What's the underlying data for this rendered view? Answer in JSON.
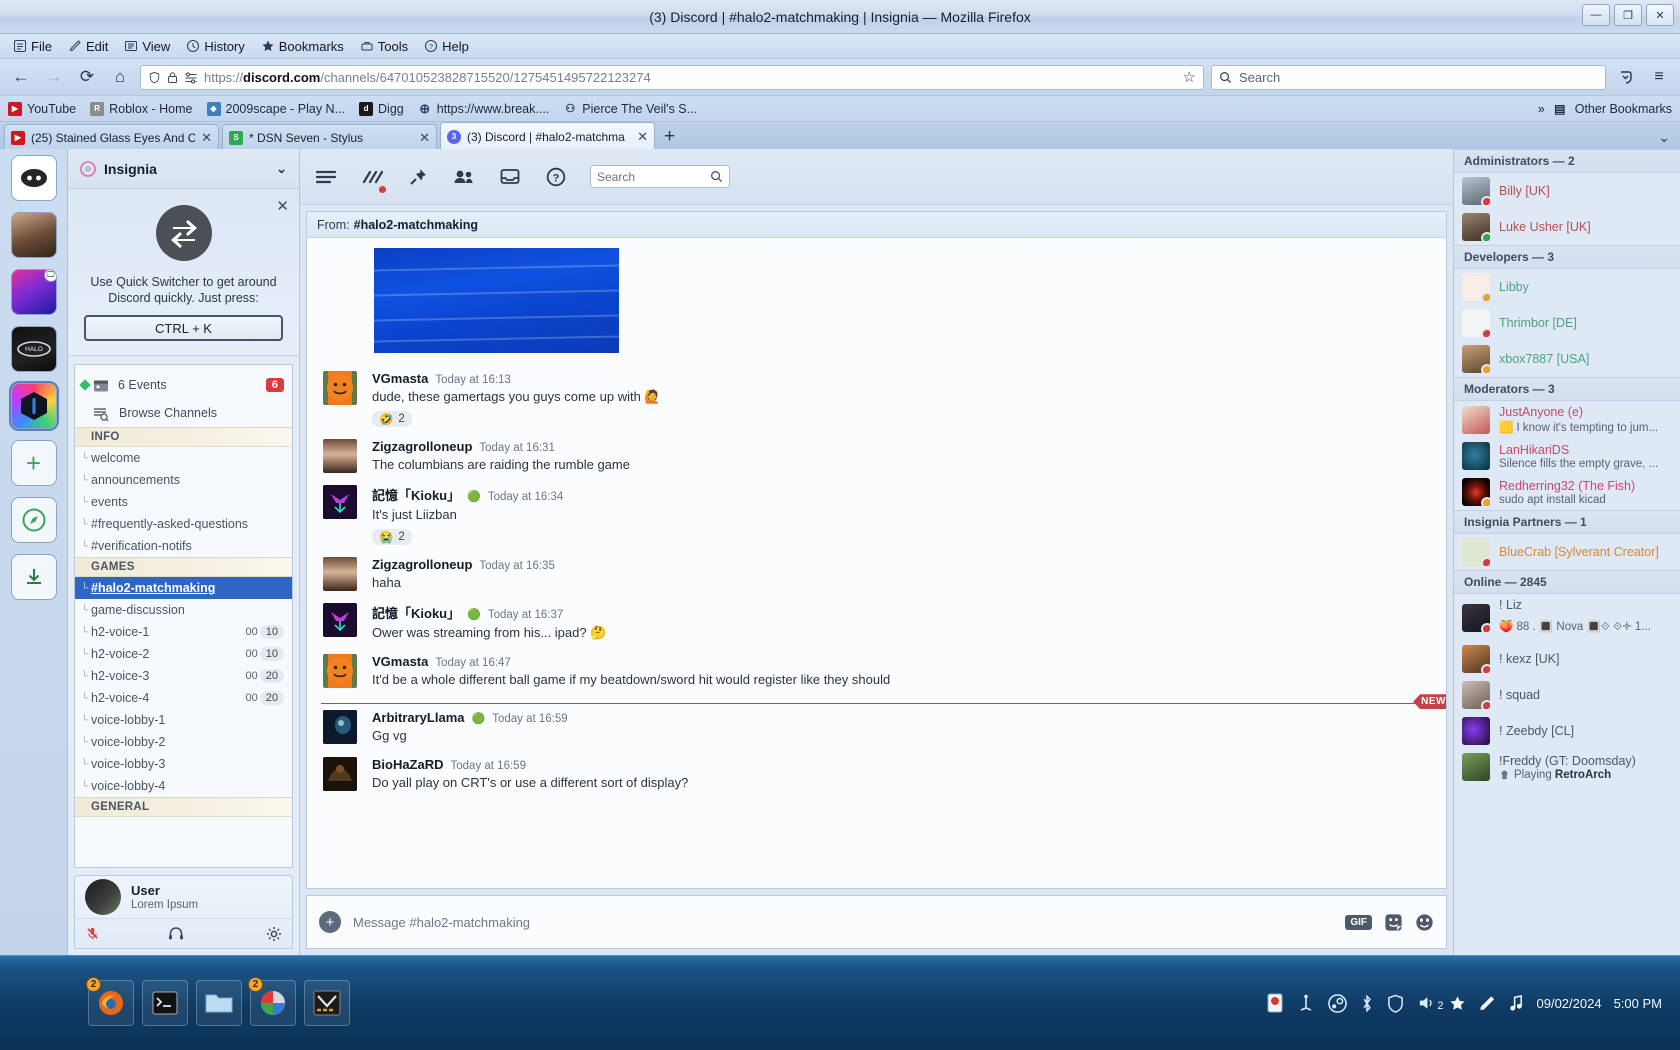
{
  "window": {
    "title": "(3) Discord | #halo2-matchmaking | Insignia — Mozilla Firefox",
    "minimize": "—",
    "restore": "❐",
    "close": "✕"
  },
  "menubar": [
    {
      "label": "File",
      "icon": "file-icon"
    },
    {
      "label": "Edit",
      "icon": "edit-pencil-icon"
    },
    {
      "label": "View",
      "icon": "view-icon"
    },
    {
      "label": "History",
      "icon": "clock-icon"
    },
    {
      "label": "Bookmarks",
      "icon": "star-icon"
    },
    {
      "label": "Tools",
      "icon": "tools-icon"
    },
    {
      "label": "Help",
      "icon": "help-circle-icon"
    }
  ],
  "nav": {
    "back": "←",
    "forward": "→",
    "reload": "⟳",
    "home": "⌂",
    "url_host": "discord.com",
    "url_path": "/channels/647010523828715520/1275451495722123274",
    "url_scheme": "https://",
    "bookmark_star": "☆",
    "search_placeholder": "Search",
    "pocket": "save-to-pocket-icon",
    "menu": "≡"
  },
  "bookmarks": {
    "items": [
      {
        "label": "YouTube",
        "color": "#cc181e",
        "glyph": "▶"
      },
      {
        "label": "Roblox - Home",
        "color": "#8c8c8c",
        "glyph": "R"
      },
      {
        "label": "2009scape - Play N...",
        "color": "#3d7fbf",
        "glyph": "◆"
      },
      {
        "label": "Digg",
        "color": "#1a1a1a",
        "glyph": "d"
      },
      {
        "label": "https://www.break....",
        "color": "#3a7fc1",
        "glyph": "⊕"
      },
      {
        "label": "Pierce The Veil's S...",
        "color": "#2b3a4d",
        "glyph": "⚇"
      }
    ],
    "overflow": "»",
    "other": "Other Bookmarks"
  },
  "tabs": [
    {
      "label": "(25) Stained Glass Eyes And C",
      "favicon": "youtube-icon",
      "color": "#cc181e",
      "glyph": "▶",
      "active": false
    },
    {
      "label": "* DSN Seven - Stylus",
      "favicon": "stylus-icon",
      "color": "#2fa84f",
      "glyph": "S",
      "active": false
    },
    {
      "label": "(3) Discord | #halo2-matchma",
      "favicon": "discord-icon",
      "color": "#5865f2",
      "glyph": "3",
      "active": true
    }
  ],
  "tabbar": {
    "new_tab": "+",
    "list_all": "⌄"
  },
  "discord": {
    "guild_name": "Insignia",
    "guild_chevron": "⌄",
    "quick_switcher": {
      "close": "✕",
      "text": "Use Quick Switcher to get around Discord quickly. Just press:",
      "shortcut": "CTRL + K"
    },
    "events": {
      "label": "6 Events",
      "badge": "6"
    },
    "browse_channels": "Browse Channels",
    "categories": [
      {
        "name": "INFO",
        "channels": [
          {
            "name": "welcome",
            "active": false
          },
          {
            "name": "announcements",
            "active": false
          },
          {
            "name": "events",
            "active": false
          },
          {
            "name": "#frequently-asked-questions",
            "active": false
          },
          {
            "name": "#verification-notifs",
            "active": false
          }
        ]
      },
      {
        "name": "GAMES",
        "channels": [
          {
            "name": "#halo2-matchmaking",
            "active": true
          },
          {
            "name": "game-discussion",
            "active": false
          },
          {
            "name": "h2-voice-1",
            "active": false,
            "count": "00",
            "limit": "10"
          },
          {
            "name": "h2-voice-2",
            "active": false,
            "count": "00",
            "limit": "10"
          },
          {
            "name": "h2-voice-3",
            "active": false,
            "count": "00",
            "limit": "20"
          },
          {
            "name": "h2-voice-4",
            "active": false,
            "count": "00",
            "limit": "20"
          },
          {
            "name": "voice-lobby-1",
            "active": false
          },
          {
            "name": "voice-lobby-2",
            "active": false
          },
          {
            "name": "voice-lobby-3",
            "active": false
          },
          {
            "name": "voice-lobby-4",
            "active": false
          }
        ]
      },
      {
        "name": "GENERAL",
        "channels": []
      }
    ],
    "user_panel": {
      "name": "User",
      "status": "Lorem Ipsum",
      "mic": "microphone-muted-icon",
      "headset": "headset-icon",
      "settings": "gear-icon"
    },
    "toolbar": {
      "threads": "threads-icon",
      "activity": "activity-icon",
      "pins": "pin-icon",
      "members": "members-icon",
      "inbox": "inbox-icon",
      "help": "help-icon",
      "search_placeholder": "Search"
    },
    "from_label": "From:",
    "from_channel": "#halo2-matchmaking",
    "new_divider": "NEW",
    "messages": [
      {
        "author": "VGmasta",
        "badge": "",
        "time": "Today at 16:13",
        "text": "dude, these gamertags you guys come up with 🙋",
        "reaction": {
          "emoji": "🤣",
          "count": "2"
        },
        "avatar_type": "smiley-orange"
      },
      {
        "author": "Zigzagrolloneup",
        "badge": "",
        "time": "Today at 16:31",
        "text": "The columbians are raiding the rumble game",
        "avatar_type": "photo-man"
      },
      {
        "author": "記憶「Kioku」",
        "badge": "🟢",
        "time": "Today at 16:34",
        "text": "It's just Liizban",
        "reaction": {
          "emoji": "😭",
          "count": "2"
        },
        "avatar_type": "purple-crest"
      },
      {
        "author": "Zigzagrolloneup",
        "badge": "",
        "time": "Today at 16:35",
        "text": "haha",
        "avatar_type": "photo-man"
      },
      {
        "author": "記憶「Kioku」",
        "badge": "🟢",
        "time": "Today at 16:37",
        "text": "Ower was streaming from his... ipad? 🤔",
        "avatar_type": "purple-crest"
      },
      {
        "author": "VGmasta",
        "badge": "",
        "time": "Today at 16:47",
        "text": "It'd be a whole different ball game if my beatdown/sword hit would register like they should",
        "avatar_type": "smiley-orange"
      },
      {
        "author": "ArbitraryLlama",
        "badge": "🟢",
        "time": "Today at 16:59",
        "text": "Gg vg",
        "avatar_type": "dark-blue"
      },
      {
        "author": "BioHaZaRD",
        "badge": "",
        "time": "Today at 16:59",
        "text": "Do yall play on CRT's or use a different sort of display?",
        "avatar_type": "dark-brown"
      }
    ],
    "composer": {
      "add": "+",
      "placeholder": "Message #halo2-matchmaking",
      "gif": "GIF",
      "sticker": "sticker-icon",
      "emoji": "emoji-icon"
    },
    "member_groups": [
      {
        "title": "Administrators — 2",
        "members": [
          {
            "name": "Billy [UK]",
            "color": "#b5504f",
            "presence": "dnd",
            "sub": "",
            "av": "#8e9aa6"
          },
          {
            "name": "Luke Usher [UK]",
            "color": "#b5504f",
            "presence": "online",
            "sub": "",
            "av": "#6b5a4c"
          }
        ]
      },
      {
        "title": "Developers — 3",
        "members": [
          {
            "name": "Libby",
            "color": "#4aa47e",
            "presence": "idle",
            "sub": "",
            "av": "#f3e9e4"
          },
          {
            "name": "Thrimbor [DE]",
            "color": "#4aa47e",
            "presence": "dnd",
            "sub": "",
            "av": "#f2f2f2"
          },
          {
            "name": "xbox7887 [USA]",
            "color": "#4aa47e",
            "presence": "idle",
            "sub": "",
            "av": "#7b6451"
          }
        ]
      },
      {
        "title": "Moderators — 3",
        "members": [
          {
            "name": "JustAnyone (e)",
            "color": "#c24b6e",
            "presence": "",
            "sub": "🟨 I know it's tempting to jum...",
            "av": "#e8cfbb"
          },
          {
            "name": "LanHikariDS",
            "color": "#c24b6e",
            "presence": "",
            "sub": "Silence fills the empty grave, ...",
            "av": "#1e5670"
          },
          {
            "name": "Redherring32 (The Fish)",
            "color": "#c24b6e",
            "presence": "idle",
            "sub": "sudo apt install kicad",
            "av": "#120608"
          }
        ]
      },
      {
        "title": "Insignia Partners — 1",
        "members": [
          {
            "name": "BlueCrab [Sylverant Creator]",
            "color": "#d08a3a",
            "presence": "dnd",
            "sub": "",
            "av": "#cfd8c0"
          }
        ]
      },
      {
        "title": "Online — 2845",
        "members": [
          {
            "name": "! Liz",
            "color": "#4c5766",
            "presence": "dnd",
            "sub": "🍑 88 . 🔳 Nova 🔳⟐ ⟐🝊      1...",
            "av": "#2b2b33"
          },
          {
            "name": "! kexz [UK]",
            "color": "#4c5766",
            "presence": "dnd",
            "sub": "",
            "av": "#b9794a"
          },
          {
            "name": "! squad",
            "color": "#4c5766",
            "presence": "dnd",
            "sub": "",
            "av": "#b0a39a"
          },
          {
            "name": "! Zeebdy [CL]",
            "color": "#4c5766",
            "presence": "",
            "sub": "",
            "av": "#3a1f5e"
          },
          {
            "name": "!Freddy (GT: Doomsday)",
            "color": "#4c5766",
            "presence": "",
            "sub": "Playing RetroArch",
            "sub_bold": "RetroArch",
            "av": "#4d7040"
          }
        ]
      }
    ]
  },
  "taskbar": {
    "apps": [
      {
        "name": "firefox-taskbar-button",
        "count": "2",
        "glyph": "🦊"
      },
      {
        "name": "terminal-taskbar-button",
        "count": "",
        "glyph": "▌"
      },
      {
        "name": "file-manager-taskbar-button",
        "count": "",
        "glyph": "🗀"
      },
      {
        "name": "gimp-taskbar-button",
        "count": "2",
        "glyph": "◉"
      },
      {
        "name": "editor-taskbar-button",
        "count": "",
        "glyph": "✓"
      }
    ],
    "tray": [
      "record-icon",
      "network-icon",
      "steam-icon",
      "bluetooth-icon",
      "shield-icon",
      "volume-icon",
      "star-icon",
      "pencil-icon",
      "music-icon"
    ],
    "volume_count": "2",
    "date": "09/02/2024",
    "time": "5:00 PM"
  }
}
